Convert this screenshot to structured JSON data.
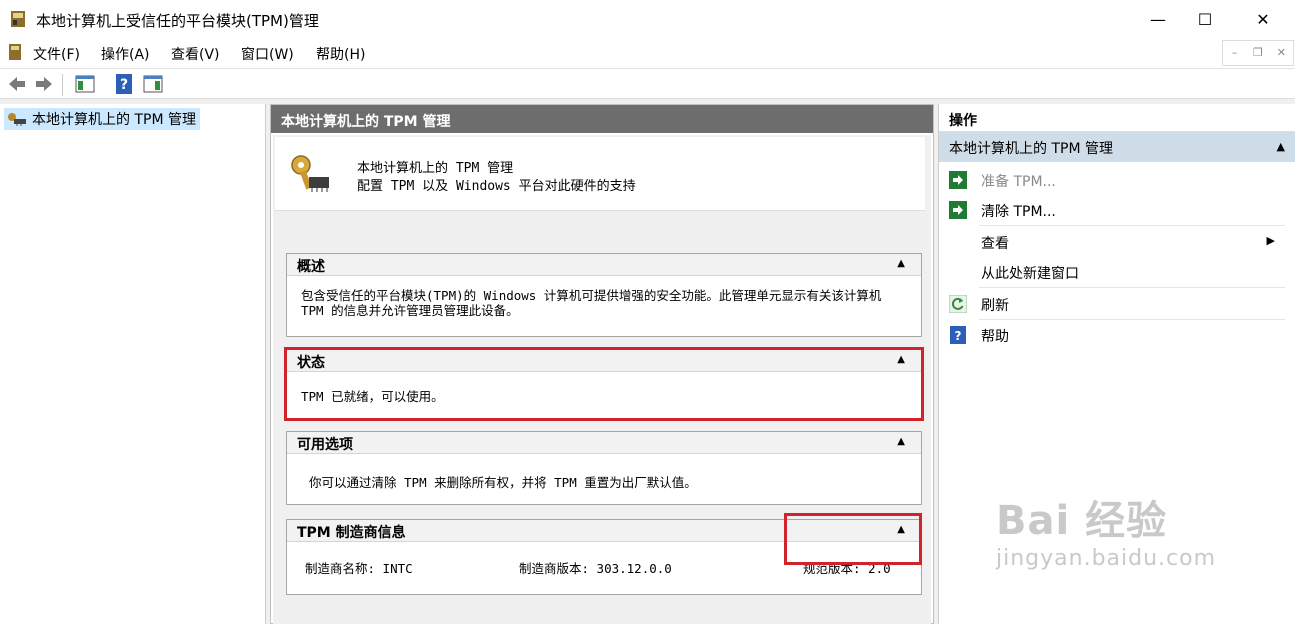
{
  "window": {
    "title": "本地计算机上受信任的平台模块(TPM)管理",
    "minimize": "—",
    "maximize": "☐",
    "close": "✕"
  },
  "menu": {
    "items": [
      "文件(F)",
      "操作(A)",
      "查看(V)",
      "窗口(W)",
      "帮助(H)"
    ]
  },
  "mdi": {
    "min": "–",
    "restore": "❐",
    "close": "✕"
  },
  "tree": {
    "root_label": "本地计算机上的 TPM 管理"
  },
  "center": {
    "header": "本地计算机上的 TPM 管理",
    "intro_title": "本地计算机上的 TPM 管理",
    "intro_sub": "配置 TPM 以及 Windows 平台对此硬件的支持",
    "overview": {
      "title": "概述",
      "text": "包含受信任的平台模块(TPM)的 Windows 计算机可提供增强的安全功能。此管理单元显示有关该计算机 TPM 的信息并允许管理员管理此设备。"
    },
    "status": {
      "title": "状态",
      "text": "TPM 已就绪，可以使用。"
    },
    "options": {
      "title": "可用选项",
      "text": "你可以通过清除 TPM 来删除所有权，并将 TPM 重置为出厂默认值。"
    },
    "manufacturer": {
      "title": "TPM 制造商信息",
      "name": "制造商名称: INTC",
      "version": "制造商版本: 303.12.0.0",
      "spec": "规范版本: 2.0"
    }
  },
  "actions": {
    "title": "操作",
    "group": "本地计算机上的 TPM 管理",
    "items": {
      "prepare": "准备 TPM...",
      "clear": "清除 TPM...",
      "view": "查看",
      "new_window": "从此处新建窗口",
      "refresh": "刷新",
      "help": "帮助"
    }
  },
  "watermark": {
    "brand": "Bai 经验",
    "url": "jingyan.baidu.com"
  }
}
